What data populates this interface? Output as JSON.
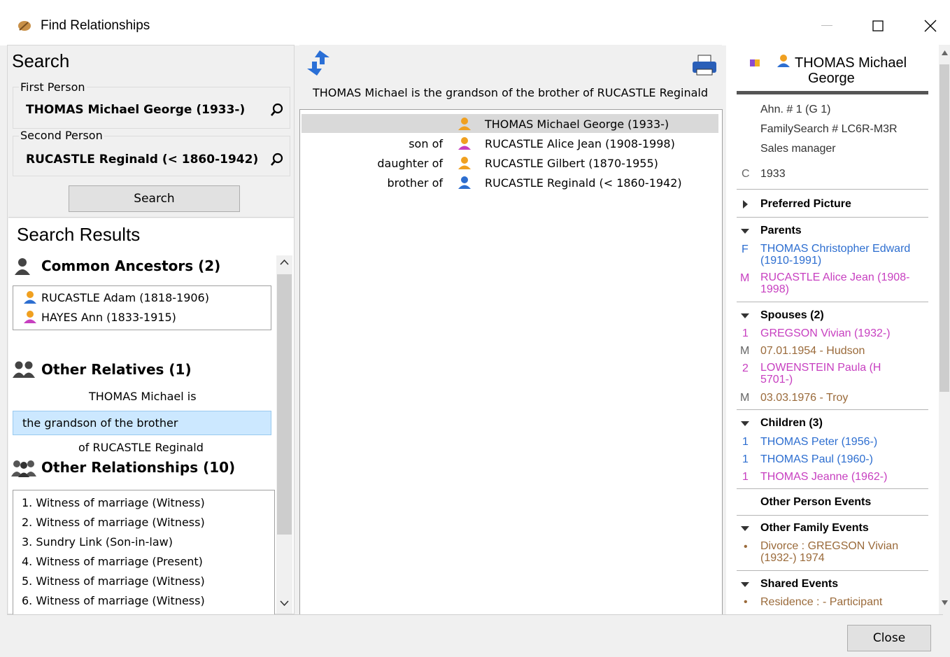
{
  "window": {
    "title": "Find Relationships",
    "icon": "feather-app-icon",
    "controls": [
      "minimize-icon",
      "maximize-icon",
      "close-icon"
    ]
  },
  "search": {
    "heading": "Search",
    "first_person_label": "First Person",
    "first_person_value": "THOMAS Michael George (1933-)",
    "second_person_label": "Second Person",
    "second_person_value": "RUCASTLE Reginald (< 1860-1942)",
    "search_button": "Search"
  },
  "results": {
    "heading": "Search Results",
    "common_ancestors": {
      "title": "Common Ancestors (2)",
      "items": [
        "RUCASTLE Adam (1818-1906)",
        "HAYES Ann (1833-1915)"
      ]
    },
    "other_relatives": {
      "title": "Other Relatives (1)",
      "prefix": "THOMAS Michael is",
      "selected": "the grandson of the brother",
      "suffix": "of RUCASTLE Reginald"
    },
    "other_relationships": {
      "title": "Other Relationships (10)",
      "items": [
        "1. Witness of marriage (Witness)",
        "2. Witness of marriage (Witness)",
        "3. Sundry Link (Son-in-law)",
        "4. Witness of marriage (Present)",
        "5. Witness of marriage (Witness)",
        "6. Witness of marriage (Witness)"
      ]
    }
  },
  "chain": {
    "caption": "THOMAS Michael is the grandson of the brother of RUCASTLE Reginald",
    "rows": [
      {
        "relation": "",
        "name": "THOMAS Michael George (1933-)",
        "gender": "male"
      },
      {
        "relation": "son of",
        "name": "RUCASTLE Alice Jean (1908-1998)",
        "gender": "female"
      },
      {
        "relation": "daughter of",
        "name": "RUCASTLE Gilbert (1870-1955)",
        "gender": "male"
      },
      {
        "relation": "brother of",
        "name": "RUCASTLE Reginald (< 1860-1942)",
        "gender": "male"
      }
    ]
  },
  "detail": {
    "name_line1": "THOMAS Michael",
    "name_line2": "George",
    "ahn": "Ahn. # 1 (G 1)",
    "familysearch": "FamilySearch # LC6R-M3R",
    "occupation": "Sales manager",
    "birth_key": "C",
    "birth_year": "1933",
    "preferred_picture": "Preferred Picture",
    "parents_head": "Parents",
    "father_key": "F",
    "father_l1": "THOMAS Christopher Edward",
    "father_l2": "(1910-1991)",
    "mother_key": "M",
    "mother_l1": "RUCASTLE Alice Jean (1908-",
    "mother_l2": "1998)",
    "spouses_head": "Spouses (2)",
    "spouse1_key": "1",
    "spouse1": "GREGSON Vivian (1932-)",
    "marr1_key": "M",
    "marr1": "07.01.1954 - Hudson",
    "spouse2_key": "2",
    "spouse2_l1": "LOWENSTEIN Paula (H",
    "spouse2_l2": "5701-)",
    "marr2_key": "M",
    "marr2": "03.03.1976 - Troy",
    "children_head": "Children (3)",
    "child1_key": "1",
    "child1": "THOMAS Peter (1956-)",
    "child2_key": "1",
    "child2": "THOMAS Paul (1960-)",
    "child3_key": "1",
    "child3": "THOMAS Jeanne (1962-)",
    "other_person_events": "Other Person Events",
    "other_family_head": "Other Family Events",
    "bullet": "•",
    "divorce_l1": "Divorce : GREGSON Vivian",
    "divorce_l2": "(1932-) 1974",
    "shared_head": "Shared Events",
    "residence": "Residence : - Participant"
  },
  "footer": {
    "close_button": "Close"
  },
  "colors": {
    "male": "#2d6ed0",
    "female": "#c73fc0",
    "event": "#9a6a3a",
    "person_icon_head": "#f0a020"
  }
}
